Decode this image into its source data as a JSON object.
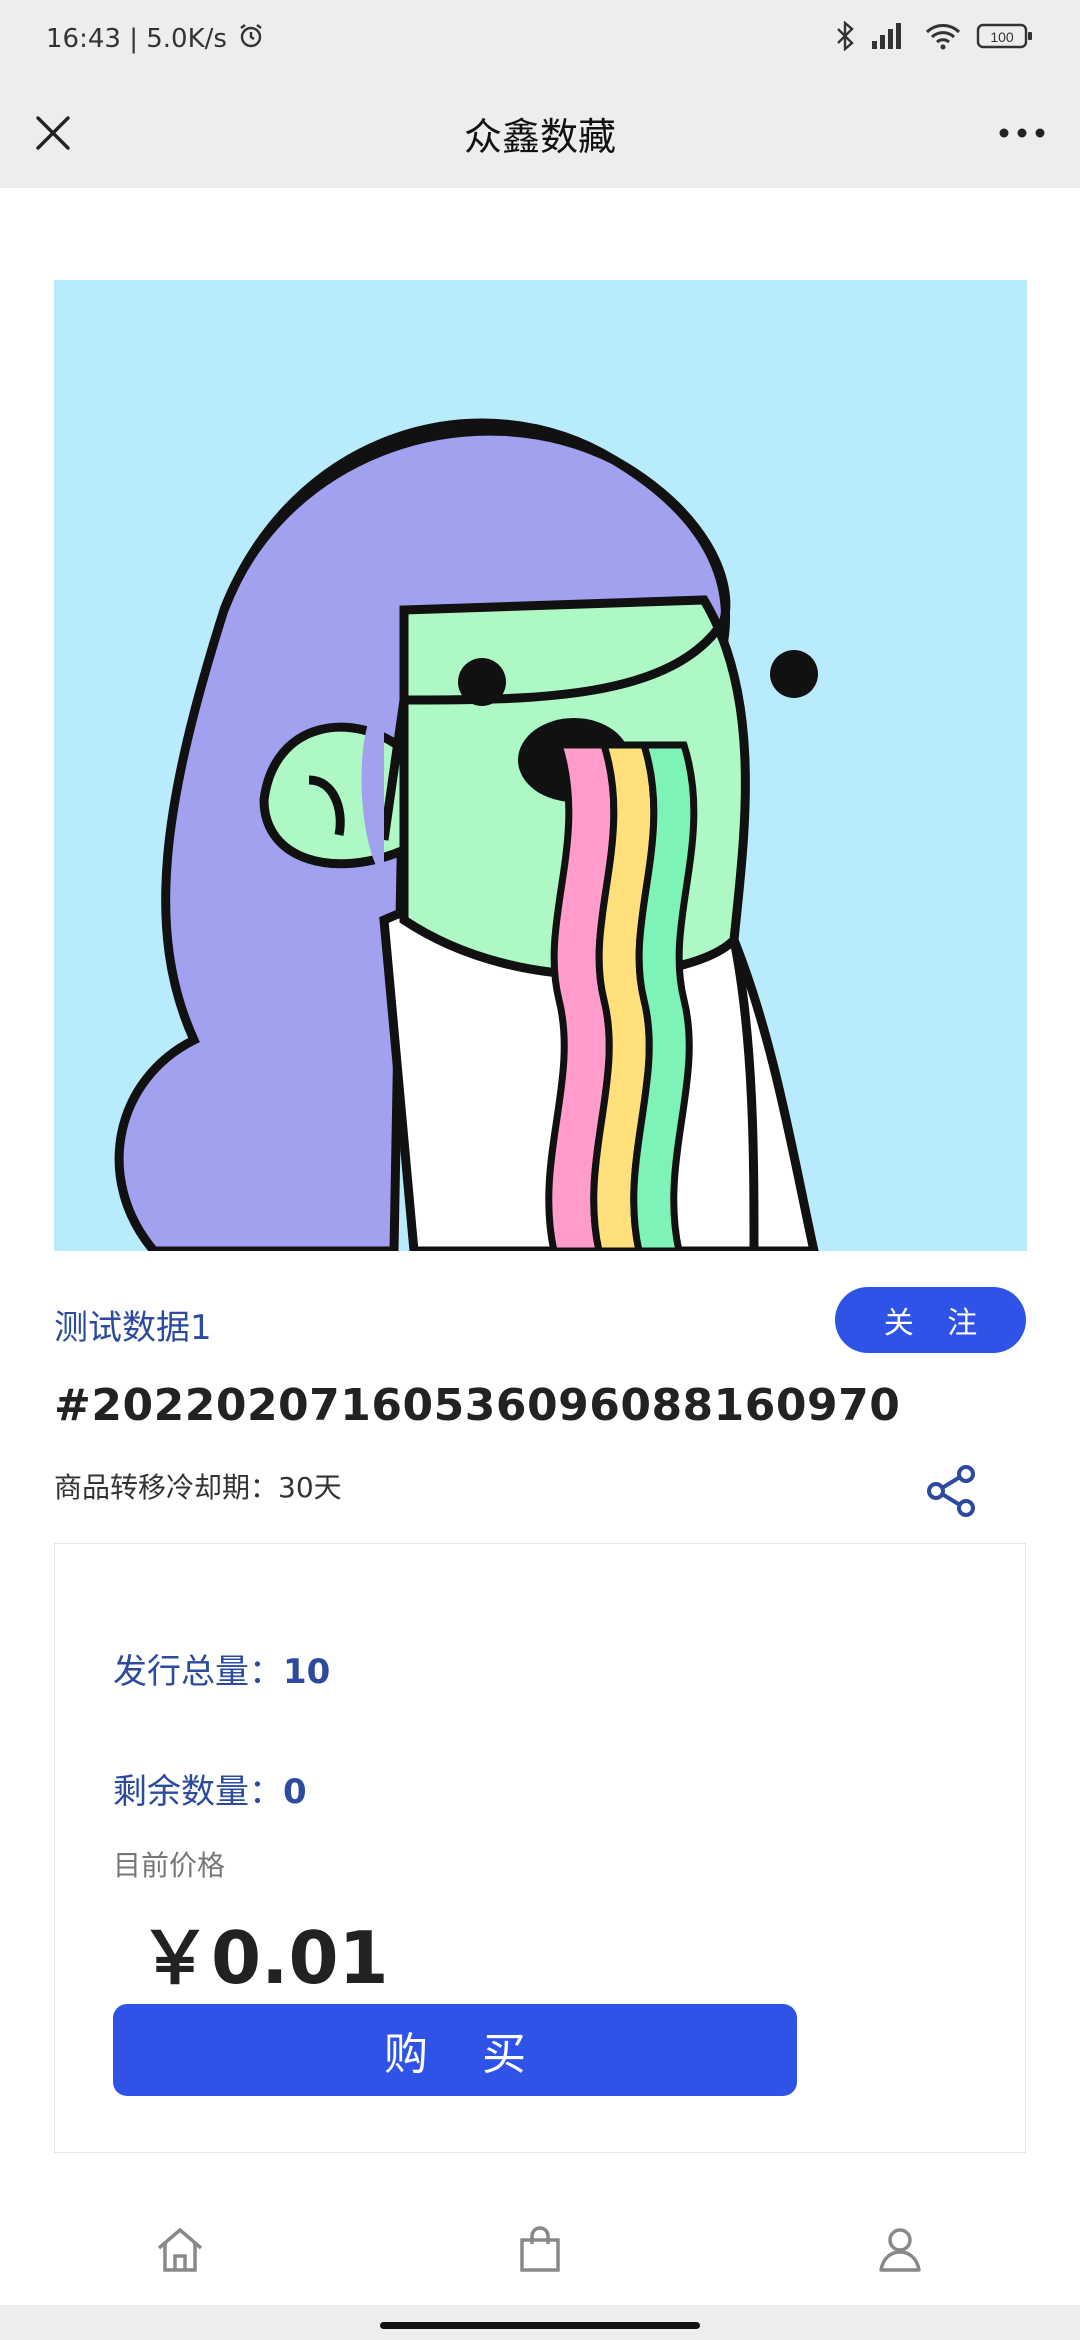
{
  "status_bar": {
    "time_speed": "16:43 | 5.0K/s",
    "battery": "100"
  },
  "nav": {
    "title": "众鑫数藏"
  },
  "product": {
    "name": "测试数据1",
    "token_id": "#20220207160536096088160970",
    "cooldown": "商品转移冷却期：30天",
    "follow_label": "关 注"
  },
  "stats": {
    "total_label": "发行总量：",
    "total_value": "10",
    "remaining_label": "剩余数量：",
    "remaining_value": "0",
    "price_label": "目前价格",
    "price": "￥0.01",
    "buy_label": "购 买"
  },
  "colors": {
    "accent": "#2f53e6",
    "link": "#2c4a9e",
    "art_background": "#b8ebfc"
  },
  "icons": {
    "close": "close-icon",
    "more": "more-icon",
    "share": "share-icon",
    "home": "home-icon",
    "bag": "bag-icon",
    "user": "user-icon"
  }
}
